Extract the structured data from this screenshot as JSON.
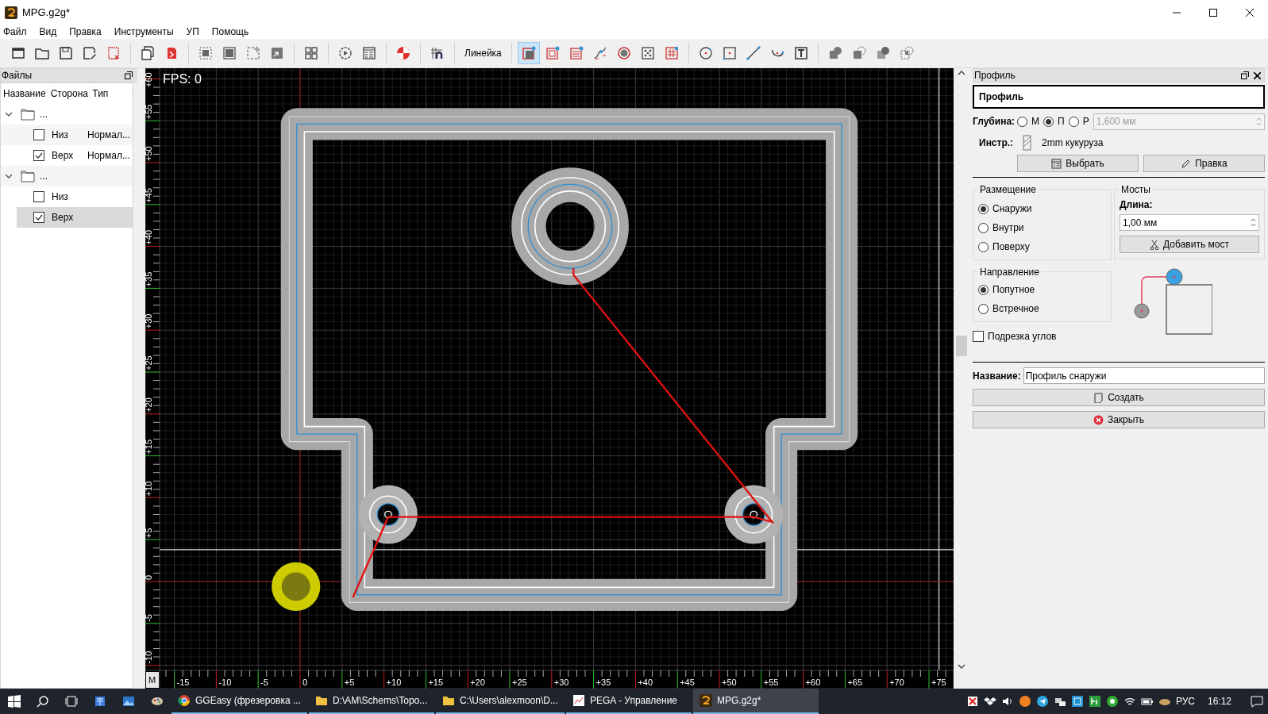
{
  "window": {
    "title": "MPG.g2g*"
  },
  "menu": [
    "Файл",
    "Вид",
    "Правка",
    "Инструменты",
    "УП",
    "Помощь"
  ],
  "toolbar": [
    {
      "kind": "icon",
      "selected": false
    },
    {
      "kind": "icon",
      "selected": false
    },
    {
      "kind": "icon",
      "selected": false
    },
    {
      "kind": "icon",
      "selected": false
    },
    {
      "kind": "icon",
      "selected": false
    },
    {
      "kind": "separator"
    },
    {
      "kind": "icon",
      "selected": false
    },
    {
      "kind": "icon",
      "selected": false
    },
    {
      "kind": "separator"
    },
    {
      "kind": "icon",
      "selected": false
    },
    {
      "kind": "icon",
      "selected": false
    },
    {
      "kind": "icon",
      "selected": false
    },
    {
      "kind": "icon",
      "selected": false
    },
    {
      "kind": "separator"
    },
    {
      "kind": "icon",
      "selected": false
    },
    {
      "kind": "separator"
    },
    {
      "kind": "icon",
      "selected": false
    },
    {
      "kind": "icon",
      "selected": false
    },
    {
      "kind": "separator"
    },
    {
      "kind": "icon",
      "selected": false
    },
    {
      "kind": "separator"
    },
    {
      "kind": "icon",
      "selected": false
    },
    {
      "kind": "separator"
    },
    {
      "kind": "label",
      "label": "Линейка"
    },
    {
      "kind": "separator"
    },
    {
      "kind": "icon",
      "selected": true
    },
    {
      "kind": "icon",
      "selected": false
    },
    {
      "kind": "icon",
      "selected": false
    },
    {
      "kind": "icon",
      "selected": false
    },
    {
      "kind": "icon",
      "selected": false
    },
    {
      "kind": "icon",
      "selected": false
    },
    {
      "kind": "icon",
      "selected": false
    },
    {
      "kind": "separator"
    },
    {
      "kind": "icon",
      "selected": false
    },
    {
      "kind": "icon",
      "selected": false
    },
    {
      "kind": "icon",
      "selected": false
    },
    {
      "kind": "icon",
      "selected": false
    },
    {
      "kind": "icon",
      "selected": false
    },
    {
      "kind": "separator"
    },
    {
      "kind": "icon",
      "selected": false
    },
    {
      "kind": "icon",
      "selected": false
    },
    {
      "kind": "icon",
      "selected": false
    },
    {
      "kind": "icon",
      "selected": false
    }
  ],
  "files_panel": {
    "title": "Файлы",
    "columns": [
      "Название",
      "Сторона",
      "Тип"
    ],
    "groups": [
      {
        "name": "...",
        "expanded": true,
        "children": [
          {
            "name": "Низ",
            "checked": false,
            "type": "Нормал...",
            "selected": false
          },
          {
            "name": "Верх",
            "checked": true,
            "type": "Нормал...",
            "selected": false
          }
        ]
      },
      {
        "name": "...",
        "expanded": true,
        "children": [
          {
            "name": "Низ",
            "checked": false,
            "selected": false
          },
          {
            "name": "Верх",
            "checked": true,
            "selected": true
          }
        ]
      }
    ]
  },
  "canvas": {
    "fps": "FPS: 0",
    "corner_button": "M",
    "x_ruler": [
      "-15",
      "-10",
      "-5",
      "0",
      "+5",
      "+10",
      "+15",
      "+20",
      "+25",
      "+30",
      "+35",
      "+40",
      "+45",
      "+50",
      "+55",
      "+60",
      "+65",
      "+70",
      "+75"
    ],
    "y_ruler": [
      "+60",
      "+55",
      "+50",
      "+45",
      "+40",
      "+35",
      "+30",
      "+25",
      "+20",
      "+15",
      "+10",
      "+5",
      "0",
      "-5",
      "-10"
    ]
  },
  "profile_panel": {
    "title": "Профиль",
    "heading": "Профиль",
    "depth": {
      "label": "Глубина:",
      "options": [
        {
          "label": "М",
          "selected": false
        },
        {
          "label": "П",
          "selected": true
        },
        {
          "label": "Р",
          "selected": false
        }
      ],
      "value": "1,600 мм",
      "disabled": true
    },
    "tool": {
      "label": "Инстр.:",
      "name": "2mm кукуруза"
    },
    "tool_buttons": [
      "Выбрать",
      "Правка"
    ],
    "placement": {
      "title": "Размещение",
      "options": [
        {
          "label": "Снаружи",
          "selected": true
        },
        {
          "label": "Внутри",
          "selected": false
        },
        {
          "label": "Поверху",
          "selected": false
        }
      ]
    },
    "bridges": {
      "title": "Мосты",
      "length_label": "Длина:",
      "length_value": "1,00 мм",
      "button": "Добавить мост"
    },
    "direction": {
      "title": "Направление",
      "options": [
        {
          "label": "Попутное",
          "selected": true
        },
        {
          "label": "Встречное",
          "selected": false
        }
      ]
    },
    "corner_trim": {
      "label": "Подрезка углов",
      "checked": false
    },
    "name": {
      "label": "Название:",
      "value": "Профиль снаружи"
    },
    "buttons": [
      "Создать",
      "Закрыть"
    ]
  },
  "taskbar": {
    "apps": [
      {
        "label": "GGEasy (фрезеровка ...",
        "selected": false
      },
      {
        "label": "D:\\AM\\Schems\\Topo...",
        "selected": false
      },
      {
        "label": "C:\\Users\\alexmoon\\D...",
        "selected": false
      },
      {
        "label": "PEGA - Управление",
        "selected": false
      },
      {
        "label": "MPG.g2g*",
        "selected": true
      }
    ],
    "language": "РУС",
    "time": "16:12"
  }
}
